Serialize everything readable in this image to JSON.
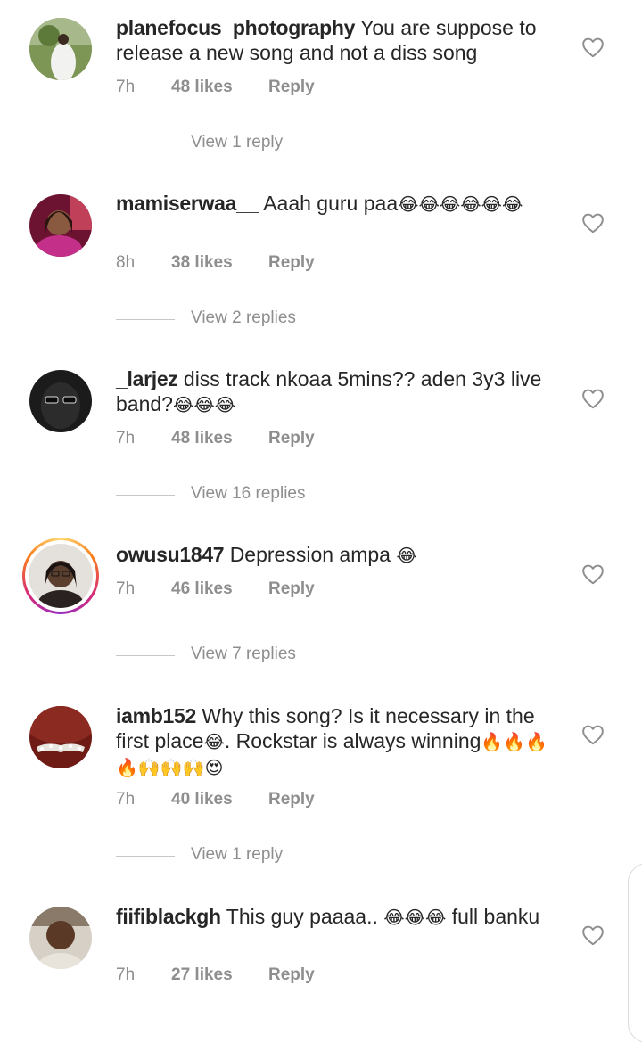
{
  "comments": [
    {
      "username": "planefocus_photography",
      "text": "You are suppose to release a new song and not a diss song",
      "emojis": "",
      "time": "7h",
      "likes": "48 likes",
      "reply": "Reply",
      "view_replies": "View 1 reply",
      "avatar_colors": [
        "#6e8b4a",
        "#b9c7a3"
      ]
    },
    {
      "username": "mamiserwaa__",
      "text": "Aaah guru paa",
      "emojis": "😂😂😂😂😂😂",
      "time": "8h",
      "likes": "38 likes",
      "reply": "Reply",
      "view_replies": "View 2 replies",
      "avatar_colors": [
        "#b0184f",
        "#e04f8c"
      ]
    },
    {
      "username": "_larjez",
      "text": "diss track nkoaa 5mins?? aden 3y3 live band?",
      "emojis": "😂😂😂",
      "time": "7h",
      "likes": "48 likes",
      "reply": "Reply",
      "view_replies": "View 16 replies",
      "avatar_colors": [
        "#1a1a1a",
        "#3a3a3a"
      ]
    },
    {
      "username": "owusu1847",
      "text": "Depression ampa",
      "emojis": "😂",
      "time": "7h",
      "likes": "46 likes",
      "reply": "Reply",
      "view_replies": "View 7 replies",
      "avatar_colors": [
        "#d9d4cf",
        "#5a4a3f"
      ],
      "has_story": true
    },
    {
      "username": "iamb152",
      "text": "Why this song? Is it necessary in the first place",
      "text2": ". Rockstar is always winning",
      "emojis": "😂",
      "emojis2": "🔥🔥🔥🔥🙌🙌🙌😍",
      "time": "7h",
      "likes": "40 likes",
      "reply": "Reply",
      "view_replies": "View 1 reply",
      "avatar_colors": [
        "#7a1f1a",
        "#c9c1b8"
      ]
    },
    {
      "username": "fiifiblackgh",
      "text": "This guy paaaa..",
      "text2": "full banku",
      "emojis": "😂😂😂",
      "time": "7h",
      "likes": "27 likes",
      "reply": "Reply",
      "view_replies": "",
      "avatar_colors": [
        "#6a4a35",
        "#d8d2c8"
      ]
    }
  ],
  "icons": {
    "heart": "heart-outline-icon"
  },
  "colors": {
    "meta_text": "#8e8e8e",
    "body_text": "#262626"
  }
}
